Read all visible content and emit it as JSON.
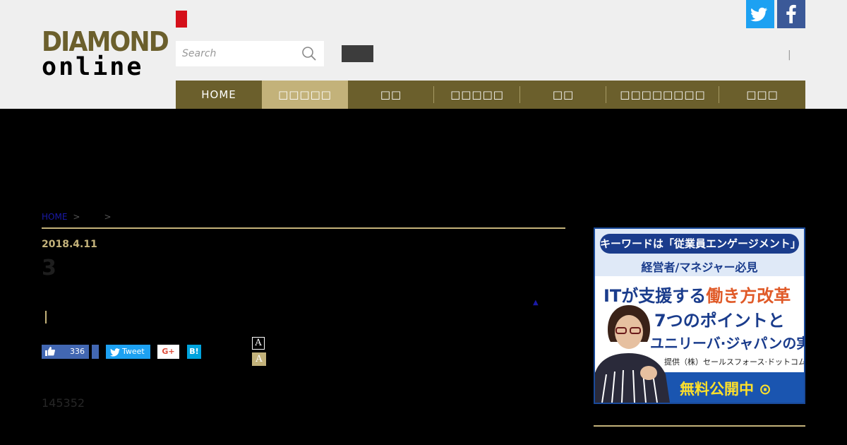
{
  "header": {
    "logo": {
      "line1": "DIAMOND",
      "line2": "online"
    },
    "search": {
      "placeholder": "Search"
    },
    "separator": "|",
    "social": {
      "twitter_icon": "twitter-bird-icon",
      "facebook_icon": "facebook-f-icon"
    }
  },
  "nav": {
    "items": [
      {
        "label": "HOME"
      },
      {
        "label": "□□□□□"
      },
      {
        "label": "□□"
      },
      {
        "label": "□□□□□"
      },
      {
        "label": "□□"
      },
      {
        "label": "□□□□□□□□"
      },
      {
        "label": "□□□"
      }
    ],
    "active_index": 1
  },
  "breadcrumb": {
    "home": "HOME",
    "sep1": ">",
    "sep2": ">"
  },
  "article": {
    "date": "2018.4.11",
    "title": "3",
    "up_marker": "▲",
    "number": "145352"
  },
  "share": {
    "like_count": "336",
    "tweet_label": "Tweet",
    "gplus_label": "G+",
    "hatena_label": "B!"
  },
  "font_size": {
    "small_label": "A",
    "large_label": "A"
  },
  "ad": {
    "pill": "キーワードは「従業員エンゲージメント」",
    "sub": "経営者/マネジャー必見",
    "h1_pre": "ITが支援する",
    "h1_accent": "働き方改革",
    "h2": "7つのポイントと",
    "h3": "ユニリーバ·ジャパンの実践",
    "credit": "提供（株）セールスフォース·ドットコム",
    "cta": "無料公開中 ⊙"
  },
  "colors": {
    "brand_gold": "#6b5f2c",
    "accent_gold": "#c3b27a",
    "ad_blue": "#1a3c8c",
    "twitter": "#1da1f2",
    "facebook": "#3b5998"
  }
}
